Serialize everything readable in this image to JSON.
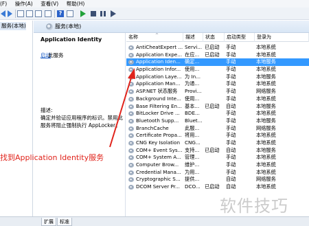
{
  "menu": {
    "items": [
      "(F)",
      "操作(A)",
      "查看(V)",
      "帮助(H)"
    ]
  },
  "toolbar": {
    "icons": [
      "back-icon",
      "forward-icon",
      "console-tree-icon",
      "properties-icon",
      "refresh-icon",
      "export-icon",
      "help-icon",
      "console-icon",
      "start-icon",
      "stop-icon",
      "pause-icon",
      "restart-icon"
    ]
  },
  "tree": {
    "selected_label": "服务(本地)"
  },
  "header": {
    "title": "服务(本地)"
  },
  "details": {
    "service_name": "Application Identity",
    "action_link": "启动",
    "action_suffix": "此服务",
    "description_label": "描述:",
    "description_text": "确定并验证应用程序的标识。禁用此服务将阻止强制执行 AppLocker。"
  },
  "columns": {
    "name": "名称",
    "description": "描述",
    "status": "状态",
    "startup": "启动类型",
    "logon": "登录为"
  },
  "services": [
    {
      "name": "AntiCheatExpert ...",
      "description": "Servi...",
      "status": "已启动",
      "startup": "手动",
      "logon": "本地系统"
    },
    {
      "name": "Application Expe...",
      "description": "在应...",
      "status": "已启动",
      "startup": "手动",
      "logon": "本地系统"
    },
    {
      "name": "Application Iden...",
      "description": "确定...",
      "status": "",
      "startup": "手动",
      "logon": "本地服务"
    },
    {
      "name": "Application Infor...",
      "description": "使用...",
      "status": "",
      "startup": "手动",
      "logon": "本地系统"
    },
    {
      "name": "Application Laye...",
      "description": "为 In...",
      "status": "",
      "startup": "手动",
      "logon": "本地服务"
    },
    {
      "name": "Application Man...",
      "description": "为通...",
      "status": "",
      "startup": "手动",
      "logon": "本地系统"
    },
    {
      "name": "ASP.NET 状态服务",
      "description": "Provi...",
      "status": "",
      "startup": "手动",
      "logon": "网络服务"
    },
    {
      "name": "Background Inte...",
      "description": "使用...",
      "status": "",
      "startup": "手动",
      "logon": "本地系统"
    },
    {
      "name": "Base Filtering En...",
      "description": "基本...",
      "status": "已启动",
      "startup": "自动",
      "logon": "本地服务"
    },
    {
      "name": "BitLocker Drive ...",
      "description": "BDE...",
      "status": "",
      "startup": "手动",
      "logon": "本地系统"
    },
    {
      "name": "Bluetooth Supp...",
      "description": "Bluet...",
      "status": "",
      "startup": "手动",
      "logon": "本地服务"
    },
    {
      "name": "BranchCache",
      "description": "此服...",
      "status": "",
      "startup": "手动",
      "logon": "网络服务"
    },
    {
      "name": "Certificate Propa...",
      "description": "将用...",
      "status": "",
      "startup": "手动",
      "logon": "本地系统"
    },
    {
      "name": "CNG Key Isolation",
      "description": "CNG...",
      "status": "",
      "startup": "手动",
      "logon": "本地系统"
    },
    {
      "name": "COM+ Event Sys...",
      "description": "支持...",
      "status": "已启动",
      "startup": "自动",
      "logon": "本地服务"
    },
    {
      "name": "COM+ System A...",
      "description": "管理...",
      "status": "",
      "startup": "手动",
      "logon": "本地系统"
    },
    {
      "name": "Computer Brow...",
      "description": "维护...",
      "status": "",
      "startup": "手动",
      "logon": "本地系统"
    },
    {
      "name": "Credential Mana...",
      "description": "为用...",
      "status": "",
      "startup": "手动",
      "logon": "本地系统"
    },
    {
      "name": "Cryptographic S...",
      "description": "提供...",
      "status": "",
      "startup": "自动",
      "logon": "网络服务"
    },
    {
      "name": "DCOM Server Pr...",
      "description": "DCO...",
      "status": "已启动",
      "startup": "自动",
      "logon": "本地系统"
    }
  ],
  "selected_index": 2,
  "tabs": [
    "扩展",
    "标准"
  ],
  "annotation": "找到Application Identity服务",
  "watermark": "软件技巧",
  "colors": {
    "selection": "#3399ff",
    "annotation": "#e0231b",
    "link": "#1256c4"
  }
}
